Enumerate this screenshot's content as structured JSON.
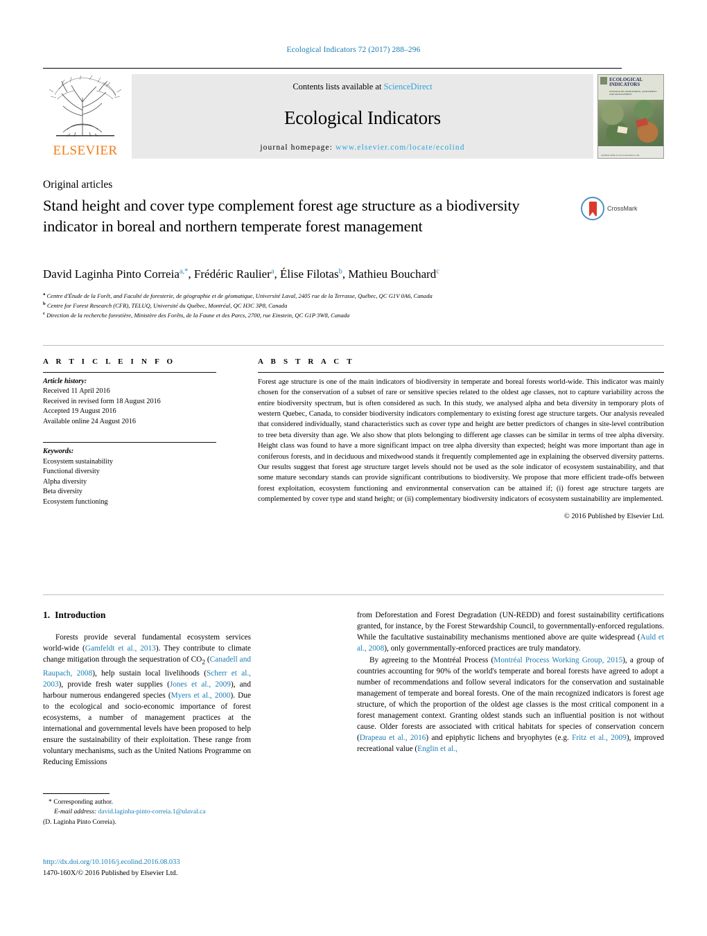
{
  "running_head": "Ecological Indicators 72 (2017) 288–296",
  "banner": {
    "contents_prefix": "Contents lists available at ",
    "contents_link": "ScienceDirect",
    "journal_name": "Ecological Indicators",
    "homepage_prefix": "journal homepage: ",
    "homepage_url": "www.elsevier.com/locate/ecolind",
    "publisher": "ELSEVIER",
    "cover": {
      "title": "ECOLOGICAL INDICATORS",
      "subtitle": "INTEGRATING MONITORING, ASSESSMENT AND MANAGEMENT",
      "footer": "Available online at www.sciencedirect.com"
    }
  },
  "section_type": "Original articles",
  "title": "Stand height and cover type complement forest age structure as a biodiversity indicator in boreal and northern temperate forest management",
  "crossmark_label": "CrossMark",
  "authors": [
    {
      "name": "David Laginha Pinto Correia",
      "marks": "a,*"
    },
    {
      "name": "Frédéric Raulier",
      "marks": "a"
    },
    {
      "name": "Élise Filotas",
      "marks": "b"
    },
    {
      "name": "Mathieu Bouchard",
      "marks": "c"
    }
  ],
  "affiliations": [
    {
      "mark": "a",
      "text": "Centre d'Étude de la Forêt, and Faculté de foresterie, de géographie et de géomatique, Université Laval, 2405 rue de la Terrasse, Québec, QC G1V 0A6, Canada"
    },
    {
      "mark": "b",
      "text": "Centre for Forest Research (CFR), TELUQ, Université du Québec, Montréal, QC H3C 3P8, Canada"
    },
    {
      "mark": "c",
      "text": "Direction de la recherche forestière, Ministère des Forêts, de la Faune et des Parcs, 2700, rue Einstein, QC G1P 3W8, Canada"
    }
  ],
  "article_info": {
    "heading": "A R T I C L E  I N F O",
    "history_label": "Article history:",
    "history": [
      "Received 11 April 2016",
      "Received in revised form 18 August 2016",
      "Accepted 19 August 2016",
      "Available online 24 August 2016"
    ],
    "keywords_label": "Keywords:",
    "keywords": [
      "Ecosystem sustainability",
      "Functional diversity",
      "Alpha diversity",
      "Beta diversity",
      "Ecosystem functioning"
    ]
  },
  "abstract": {
    "heading": "A B S T R A C T",
    "text": "Forest age structure is one of the main indicators of biodiversity in temperate and boreal forests world-wide. This indicator was mainly chosen for the conservation of a subset of rare or sensitive species related to the oldest age classes, not to capture variability across the entire biodiversity spectrum, but is often considered as such. In this study, we analysed alpha and beta diversity in temporary plots of western Quebec, Canada, to consider biodiversity indicators complementary to existing forest age structure targets. Our analysis revealed that considered individually, stand characteristics such as cover type and height are better predictors of changes in site-level contribution to tree beta diversity than age. We also show that plots belonging to different age classes can be similar in terms of tree alpha diversity. Height class was found to have a more significant impact on tree alpha diversity than expected; height was more important than age in coniferous forests, and in deciduous and mixedwood stands it frequently complemented age in explaining the observed diversity patterns. Our results suggest that forest age structure target levels should not be used as the sole indicator of ecosystem sustainability, and that some mature secondary stands can provide significant contributions to biodiversity. We propose that more efficient trade-offs between forest exploitation, ecosystem functioning and environmental conservation can be attained if; (i) forest age structure targets are complemented by cover type and stand height; or (ii) complementary biodiversity indicators of ecosystem sustainability are implemented.",
    "copyright": "© 2016 Published by Elsevier Ltd."
  },
  "introduction": {
    "number": "1.",
    "heading": "Introduction",
    "left_paragraph_1_parts": [
      {
        "t": "Forests provide several fundamental ecosystem services world-wide (",
        "c": false
      },
      {
        "t": "Gamfeldt et al., 2013",
        "c": true
      },
      {
        "t": "). They contribute to climate change mitigation through the sequestration of CO",
        "c": false
      },
      {
        "t": "2",
        "c": false,
        "sub": true
      },
      {
        "t": " (",
        "c": false
      },
      {
        "t": "Canadell and Raupach, 2008",
        "c": true
      },
      {
        "t": "), help sustain local livelihoods (",
        "c": false
      },
      {
        "t": "Scherr et al., 2003",
        "c": true
      },
      {
        "t": "), provide fresh water supplies (",
        "c": false
      },
      {
        "t": "Jones et al., 2009",
        "c": true
      },
      {
        "t": "), and harbour numerous endangered species (",
        "c": false
      },
      {
        "t": "Myers et al., 2000",
        "c": true
      },
      {
        "t": "). Due to the ecological and socio-economic importance of forest ecosystems, a number of management practices at the international and governmental levels have been proposed to help ensure the sustainability of their exploitation. These range from voluntary mechanisms, such as the United Nations Programme on Reducing Emissions",
        "c": false
      }
    ],
    "right_paragraph_1_parts": [
      {
        "t": "from Deforestation and Forest Degradation (UN-REDD) and forest sustainability certifications granted, for instance, by the Forest Stewardship Council, to governmentally-enforced regulations. While the facultative sustainability mechanisms mentioned above are quite widespread (",
        "c": false
      },
      {
        "t": "Auld et al., 2008",
        "c": true
      },
      {
        "t": "), only governmentally-enforced practices are truly mandatory.",
        "c": false
      }
    ],
    "right_paragraph_2_parts": [
      {
        "t": "By agreeing to the Montréal Process (",
        "c": false
      },
      {
        "t": "Montréal Process Working Group, 2015",
        "c": true
      },
      {
        "t": "), a group of countries accounting for 90% of the world's temperate and boreal forests have agreed to adopt a number of recommendations and follow several indicators for the conservation and sustainable management of temperate and boreal forests. One of the main recognized indicators is forest age structure, of which the proportion of the oldest age classes is the most critical component in a forest management context. Granting oldest stands such an influential position is not without cause. Older forests are associated with critical habitats for species of conservation concern (",
        "c": false
      },
      {
        "t": "Drapeau et al., 2016",
        "c": true
      },
      {
        "t": ") and epiphytic lichens and bryophytes (e.g. ",
        "c": false
      },
      {
        "t": "Fritz et al., 2009",
        "c": true
      },
      {
        "t": "), improved recreational value (",
        "c": false
      },
      {
        "t": "Englin et al.,",
        "c": true
      }
    ]
  },
  "footnote": {
    "corresponding": "* Corresponding author.",
    "email_label": "E-mail address:",
    "email": "david.laginha-pinto-correia.1@ulaval.ca",
    "email_owner": "(D. Laginha Pinto Correia)."
  },
  "doi_block": {
    "doi": "http://dx.doi.org/10.1016/j.ecolind.2016.08.033",
    "issn_line": "1470-160X/© 2016 Published by Elsevier Ltd."
  },
  "colors": {
    "link": "#1a7db5",
    "sciencedirect": "#2da3d6",
    "elsevier_orange": "#ef7d18",
    "banner_bg": "#e9e9e9"
  }
}
